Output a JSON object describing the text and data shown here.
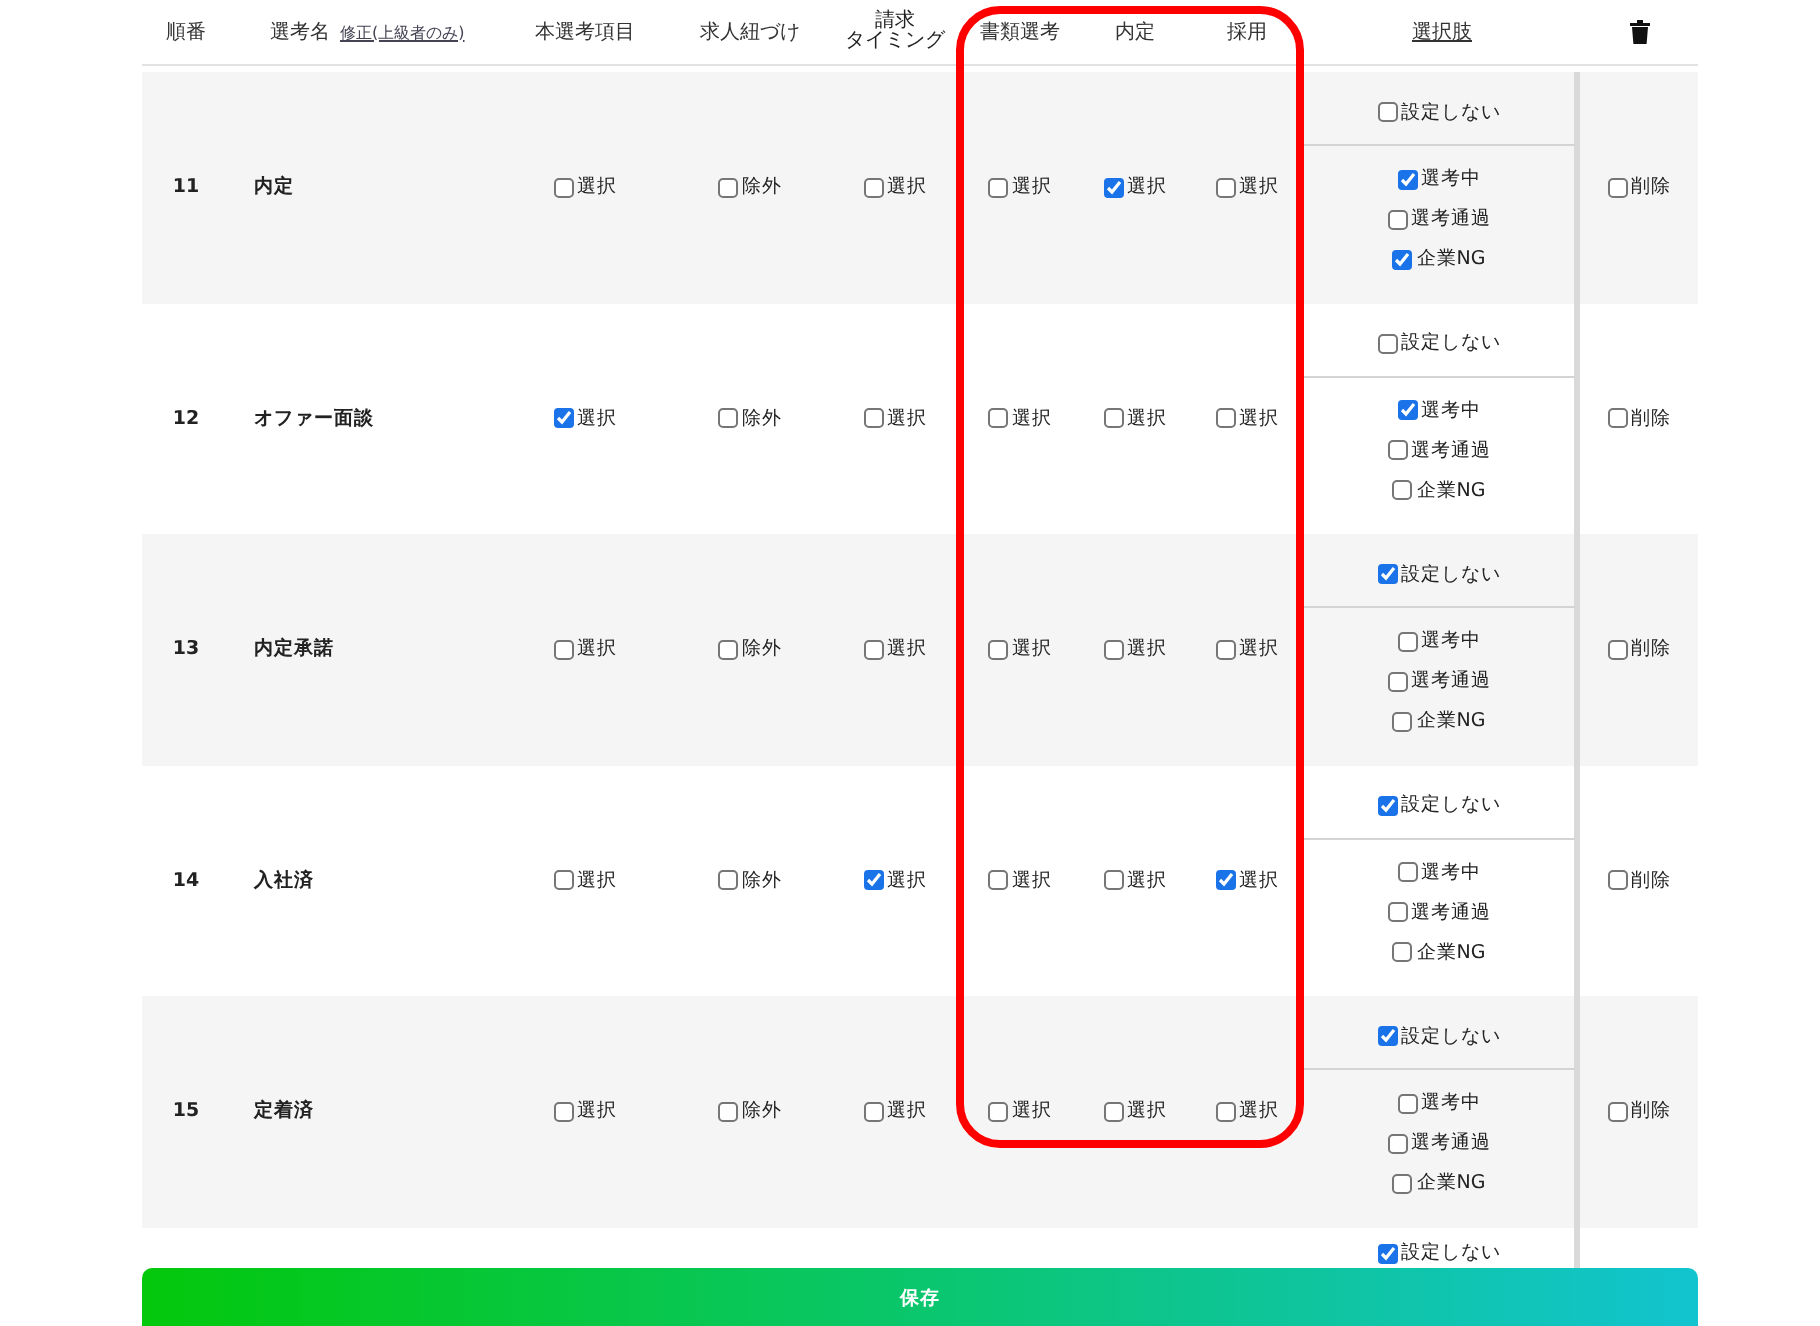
{
  "header": {
    "order": "順番",
    "name": "選考名",
    "edit_link": "修正(上級者のみ)",
    "main": "本選考項目",
    "job_link": "求人紐づけ",
    "billing": [
      "請求",
      "タイミング"
    ],
    "document": "書類選考",
    "offer": "内定",
    "hire": "採用",
    "choices_link": "選択肢"
  },
  "rows": [
    {
      "number": "11",
      "name": "内定",
      "main": {
        "label": "選択",
        "checked": false
      },
      "job_link": {
        "label": "除外",
        "checked": false
      },
      "billing": {
        "label": "選択",
        "checked": false
      },
      "document": {
        "label": "選択",
        "checked": false
      },
      "offer": {
        "label": "選択",
        "checked": true
      },
      "hire": {
        "label": "選択",
        "checked": false
      },
      "none_option": {
        "label": "設定しない",
        "checked": false
      },
      "options": [
        {
          "label": "選考中",
          "checked": true
        },
        {
          "label": "選考通過",
          "checked": false
        },
        {
          "label": "企業NG",
          "checked": true
        }
      ],
      "delete": {
        "label": "削除",
        "checked": false
      }
    },
    {
      "number": "12",
      "name": "オファー面談",
      "main": {
        "label": "選択",
        "checked": true
      },
      "job_link": {
        "label": "除外",
        "checked": false
      },
      "billing": {
        "label": "選択",
        "checked": false
      },
      "document": {
        "label": "選択",
        "checked": false
      },
      "offer": {
        "label": "選択",
        "checked": false
      },
      "hire": {
        "label": "選択",
        "checked": false
      },
      "none_option": {
        "label": "設定しない",
        "checked": false
      },
      "options": [
        {
          "label": "選考中",
          "checked": true
        },
        {
          "label": "選考通過",
          "checked": false
        },
        {
          "label": "企業NG",
          "checked": false
        }
      ],
      "delete": {
        "label": "削除",
        "checked": false
      }
    },
    {
      "number": "13",
      "name": "内定承諾",
      "main": {
        "label": "選択",
        "checked": false
      },
      "job_link": {
        "label": "除外",
        "checked": false
      },
      "billing": {
        "label": "選択",
        "checked": false
      },
      "document": {
        "label": "選択",
        "checked": false
      },
      "offer": {
        "label": "選択",
        "checked": false
      },
      "hire": {
        "label": "選択",
        "checked": false
      },
      "none_option": {
        "label": "設定しない",
        "checked": true
      },
      "options": [
        {
          "label": "選考中",
          "checked": false
        },
        {
          "label": "選考通過",
          "checked": false
        },
        {
          "label": "企業NG",
          "checked": false
        }
      ],
      "delete": {
        "label": "削除",
        "checked": false
      }
    },
    {
      "number": "14",
      "name": "入社済",
      "main": {
        "label": "選択",
        "checked": false
      },
      "job_link": {
        "label": "除外",
        "checked": false
      },
      "billing": {
        "label": "選択",
        "checked": true
      },
      "document": {
        "label": "選択",
        "checked": false
      },
      "offer": {
        "label": "選択",
        "checked": false
      },
      "hire": {
        "label": "選択",
        "checked": true
      },
      "none_option": {
        "label": "設定しない",
        "checked": true
      },
      "options": [
        {
          "label": "選考中",
          "checked": false
        },
        {
          "label": "選考通過",
          "checked": false
        },
        {
          "label": "企業NG",
          "checked": false
        }
      ],
      "delete": {
        "label": "削除",
        "checked": false
      }
    },
    {
      "number": "15",
      "name": "定着済",
      "main": {
        "label": "選択",
        "checked": false
      },
      "job_link": {
        "label": "除外",
        "checked": false
      },
      "billing": {
        "label": "選択",
        "checked": false
      },
      "document": {
        "label": "選択",
        "checked": false
      },
      "offer": {
        "label": "選択",
        "checked": false
      },
      "hire": {
        "label": "選択",
        "checked": false
      },
      "none_option": {
        "label": "設定しない",
        "checked": true
      },
      "options": [
        {
          "label": "選考中",
          "checked": false
        },
        {
          "label": "選考通過",
          "checked": false
        },
        {
          "label": "企業NG",
          "checked": false
        }
      ],
      "delete": {
        "label": "削除",
        "checked": false
      }
    }
  ],
  "cut_off_row": {
    "none_option": {
      "label": "設定しない",
      "checked": true
    }
  },
  "save_button": "保存"
}
